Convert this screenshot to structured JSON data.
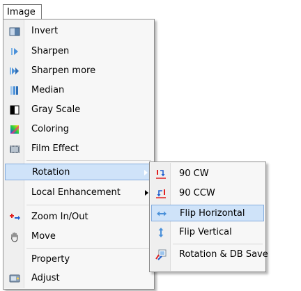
{
  "menubar": {
    "image_label": "Image"
  },
  "menu": {
    "items": [
      {
        "label": "Invert",
        "icon": "invert-icon"
      },
      {
        "label": "Sharpen",
        "icon": "sharpen-icon"
      },
      {
        "label": "Sharpen more",
        "icon": "sharpen-more-icon"
      },
      {
        "label": "Median",
        "icon": "median-icon"
      },
      {
        "label": "Gray Scale",
        "icon": "gray-scale-icon"
      },
      {
        "label": "Coloring",
        "icon": "coloring-icon"
      },
      {
        "label": "Film Effect",
        "icon": "film-effect-icon"
      },
      {
        "label": "Rotation",
        "icon": "none",
        "submenu": true,
        "highlighted": true
      },
      {
        "label": "Local Enhancement",
        "icon": "none",
        "submenu": true
      },
      {
        "label": "Zoom In/Out",
        "icon": "zoom-icon"
      },
      {
        "label": "Move",
        "icon": "hand-icon"
      },
      {
        "label": "Property",
        "icon": "none"
      },
      {
        "label": "Adjust",
        "icon": "adjust-icon"
      }
    ]
  },
  "submenu": {
    "items": [
      {
        "label": "90 CW",
        "icon": "rotate-cw-icon"
      },
      {
        "label": "90 CCW",
        "icon": "rotate-ccw-icon"
      },
      {
        "label": "Flip Horizontal",
        "icon": "flip-horizontal-icon",
        "highlighted": true
      },
      {
        "label": "Flip Vertical",
        "icon": "flip-vertical-icon"
      },
      {
        "label": "Rotation & DB Save",
        "icon": "rotation-db-save-icon"
      }
    ]
  },
  "colors": {
    "highlight_bg": "#cfe3f9",
    "highlight_border": "#84acdd",
    "menu_bg": "#f7f7f7"
  }
}
